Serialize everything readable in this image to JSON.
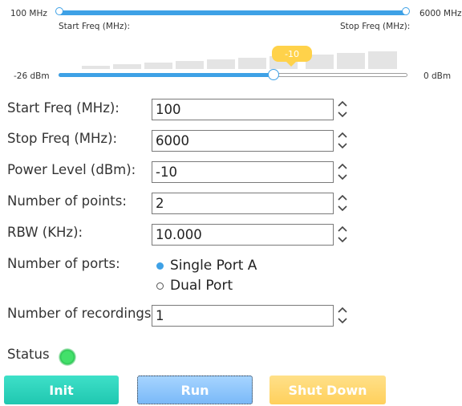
{
  "freq_range": {
    "min_label": "100 MHz",
    "max_label": "6000 MHz",
    "start_caption": "Start Freq (MHz):",
    "stop_caption": "Stop Freq (MHz):"
  },
  "power_slider": {
    "min_label": "-26 dBm",
    "max_label": "0 dBm",
    "value_label": "-10",
    "value_fraction": 0.615
  },
  "form": {
    "start_freq": {
      "label": "Start Freq (MHz):",
      "value": "100"
    },
    "stop_freq": {
      "label": "Stop Freq (MHz):",
      "value": "6000"
    },
    "power_level": {
      "label": "Power Level (dBm):",
      "value": "-10"
    },
    "num_points": {
      "label": "Number of points:",
      "value": "2"
    },
    "rbw": {
      "label": "RBW (KHz):",
      "value": "10.000"
    },
    "num_ports": {
      "label": "Number of ports:",
      "options": [
        {
          "label": "Single Port A",
          "selected": true
        },
        {
          "label": "Dual Port",
          "selected": false
        }
      ]
    },
    "num_recordings": {
      "label": "Number of recordings:",
      "value": "1"
    }
  },
  "status": {
    "label": "Status",
    "color": "#2cc654"
  },
  "buttons": {
    "init": "Init",
    "run": "Run",
    "shutdown": "Shut Down"
  }
}
